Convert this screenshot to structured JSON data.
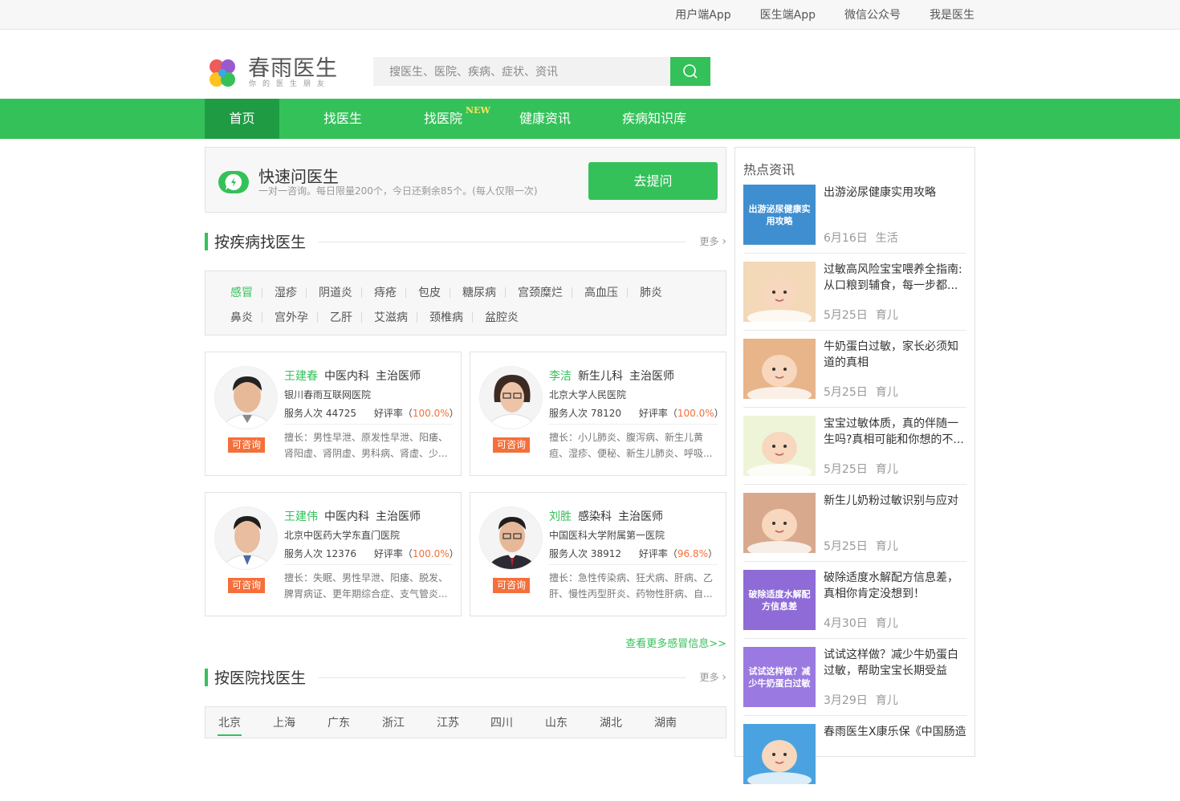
{
  "topbar": {
    "links": [
      "用户端App",
      "医生端App",
      "微信公众号",
      "我是医生"
    ]
  },
  "header": {
    "brand": "春雨医生",
    "slogan": "你的医生朋友",
    "search_placeholder": "搜医生、医院、疾病、症状、资讯"
  },
  "nav": {
    "items": [
      "首页",
      "找医生",
      "找医院",
      "健康资讯",
      "疾病知识库"
    ],
    "new_badge": "NEW",
    "active": "首页"
  },
  "quick": {
    "title": "快速问医生",
    "desc": "一对一咨询。每日限量200个，今日还剩余85个。(每人仅限一次)",
    "button": "去提问"
  },
  "by_disease": {
    "heading": "按疾病找医生",
    "more": "更多",
    "diseases_row1": [
      "感冒",
      "湿疹",
      "阴道炎",
      "痔疮",
      "包皮",
      "糖尿病",
      "宫颈糜烂",
      "高血压",
      "肺炎"
    ],
    "diseases_row2": [
      "鼻炎",
      "宫外孕",
      "乙肝",
      "艾滋病",
      "颈椎病",
      "盆腔炎"
    ],
    "active": "感冒"
  },
  "doctors": [
    {
      "name": "王建春",
      "dept": "中医内科",
      "title": "主治医师",
      "hospital": "银川春雨互联网医院",
      "served_label": "服务人次",
      "served": "44725",
      "rating_label": "好评率",
      "rating": "100.0%",
      "consult": "可咨询",
      "skill": "擅长：男性早泄、原发性早泄、阳痿、肾阳虚、肾阴虚、男科病、肾虚、少..."
    },
    {
      "name": "李洁",
      "dept": "新生儿科",
      "title": "主治医师",
      "hospital": "北京大学人民医院",
      "served_label": "服务人次",
      "served": "78120",
      "rating_label": "好评率",
      "rating": "100.0%",
      "consult": "可咨询",
      "skill": "擅长：小儿肺炎、腹泻病、新生儿黄疸、湿疹、便秘、新生儿肺炎、呼吸..."
    },
    {
      "name": "王建伟",
      "dept": "中医内科",
      "title": "主治医师",
      "hospital": "北京中医药大学东直门医院",
      "served_label": "服务人次",
      "served": "12376",
      "rating_label": "好评率",
      "rating": "100.0%",
      "consult": "可咨询",
      "skill": "擅长：失眠、男性早泄、阳痿、脱发、脾胃病证、更年期综合症、支气管炎..."
    },
    {
      "name": "刘胜",
      "dept": "感染科",
      "title": "主治医师",
      "hospital": "中国医科大学附属第一医院",
      "served_label": "服务人次",
      "served": "38912",
      "rating_label": "好评率",
      "rating": "96.8%",
      "consult": "可咨询",
      "skill": "擅长：急性传染病、狂犬病、肝病、乙肝、慢性丙型肝炎、药物性肝病、自..."
    }
  ],
  "more_link": "查看更多感冒信息>>",
  "by_hospital": {
    "heading": "按医院找医生",
    "more": "更多",
    "cities": [
      "北京",
      "上海",
      "广东",
      "浙江",
      "江苏",
      "四川",
      "山东",
      "湖北",
      "湖南"
    ],
    "active": "北京"
  },
  "hot_news": {
    "title": "热点资讯",
    "items": [
      {
        "title": "出游泌尿健康实用攻略",
        "date": "6月16日",
        "tag": "生活",
        "thumb_text": "出游泌尿健康实用攻略",
        "color": "#3f8fd0"
      },
      {
        "title": "过敏高风险宝宝喂养全指南:从口粮到辅食，每一步都...",
        "date": "5月25日",
        "tag": "育儿",
        "thumb_text": "",
        "color": "#f3d9b8"
      },
      {
        "title": "牛奶蛋白过敏，家长必须知道的真相",
        "date": "5月25日",
        "tag": "育儿",
        "thumb_text": "",
        "color": "#e8b48a"
      },
      {
        "title": "宝宝过敏体质，真的伴随一生吗?真相可能和你想的不...",
        "date": "5月25日",
        "tag": "育儿",
        "thumb_text": "",
        "color": "#eef4d8"
      },
      {
        "title": "新生儿奶粉过敏识别与应对",
        "date": "5月25日",
        "tag": "育儿",
        "thumb_text": "",
        "color": "#d9a98d"
      },
      {
        "title": "破除适度水解配方信息差，真相你肯定没想到！",
        "date": "4月30日",
        "tag": "育儿",
        "thumb_text": "破除适度水解配方信息差",
        "color": "#8e6bd6"
      },
      {
        "title": "试试这样做？减少牛奶蛋白过敏，帮助宝宝长期受益",
        "date": "3月29日",
        "tag": "育儿",
        "thumb_text": "试试这样做？减少牛奶蛋白过敏",
        "color": "#9a7ae0"
      },
      {
        "title": "春雨医生X康乐保《中国肠造",
        "date": "",
        "tag": "",
        "thumb_text": "",
        "color": "#4aa3e0"
      }
    ]
  }
}
